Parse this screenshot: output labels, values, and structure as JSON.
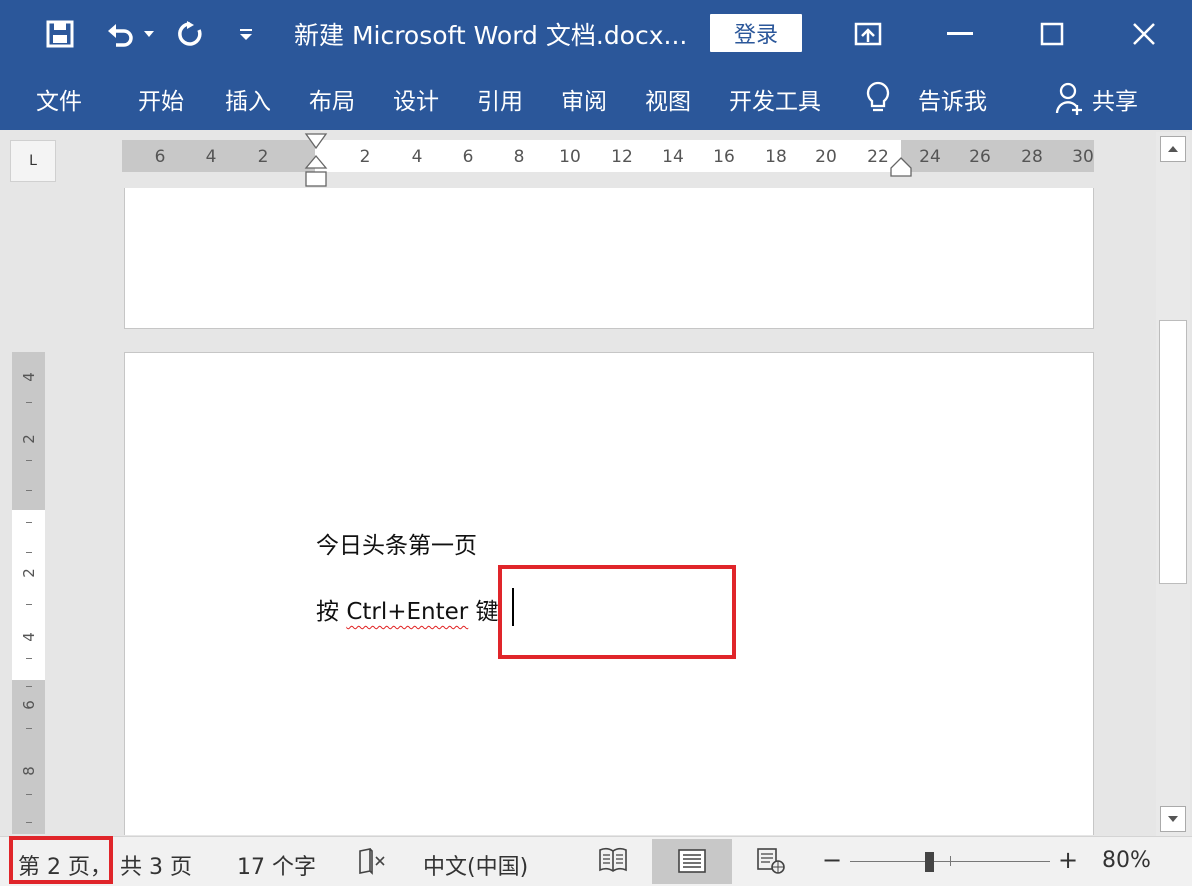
{
  "window": {
    "title": "新建 Microsoft Word 文档.docx...",
    "login_label": "登录"
  },
  "ribbon": {
    "tabs": [
      "文件",
      "开始",
      "插入",
      "布局",
      "设计",
      "引用",
      "审阅",
      "视图",
      "开发工具"
    ],
    "tell_me": "告诉我",
    "share": "共享"
  },
  "ruler": {
    "corner": "L",
    "h_labels": [
      "6",
      "4",
      "2",
      "2",
      "4",
      "6",
      "8",
      "10",
      "12",
      "14",
      "16",
      "18",
      "20",
      "22",
      "24",
      "26",
      "28",
      "30"
    ],
    "v_labels": [
      "4",
      "2",
      "2",
      "4",
      "6",
      "8"
    ]
  },
  "document": {
    "line1": "今日头条第一页",
    "line2_prefix": "按 ",
    "line2_underlined": "Ctrl+Enter",
    "line2_suffix": " 键"
  },
  "status": {
    "page_info": "第 2 页，",
    "page_total": "共 3 页",
    "word_count": "17 个字",
    "language": "中文(中国)",
    "zoom_minus": "−",
    "zoom_plus": "+",
    "zoom_level": "80%"
  },
  "colors": {
    "accent": "#2b579a",
    "highlight": "#e0252a"
  }
}
